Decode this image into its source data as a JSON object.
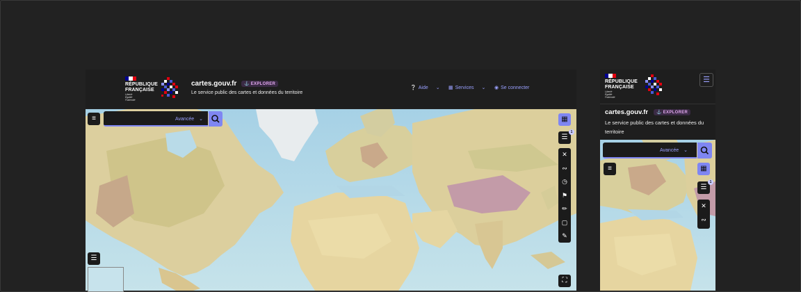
{
  "republic": {
    "line1": "RÉPUBLIQUE",
    "line2": "FRANÇAISE",
    "motto1": "Liberté",
    "motto2": "Égalité",
    "motto3": "Fraternité"
  },
  "site": {
    "title": "cartes.gouv.fr",
    "badge": "EXPLORER",
    "tagline": "Le service public des cartes et données du territoire"
  },
  "nav": {
    "help": "Aide",
    "services": "Services",
    "login": "Se connecter"
  },
  "search": {
    "advanced_label": "Avancée",
    "placeholder": ""
  },
  "toolbar": {
    "layers_count": "1"
  },
  "icons": {
    "help": "question-circle-icon",
    "services": "grid-icon",
    "login": "user-icon",
    "menu": "hamburger-menu-icon"
  },
  "colors": {
    "accent": "#7f86f2",
    "header_bg": "#1e1e1e",
    "badge_bg": "#3a2a44",
    "badge_text": "#e0a6ee",
    "flag_blue": "#000091",
    "flag_red": "#e1000f"
  }
}
